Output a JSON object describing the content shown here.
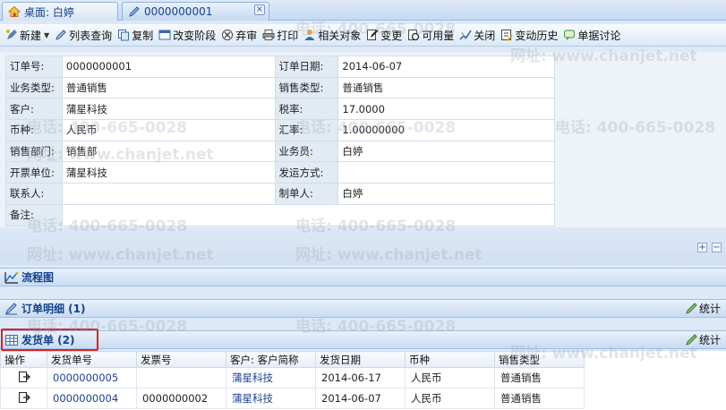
{
  "tabs": {
    "home_label": "桌面: 白婷",
    "doc_label": "0000000001",
    "close_glyph": "×"
  },
  "toolbar": {
    "new": "新建",
    "list_query": "列表查询",
    "copy": "复制",
    "change_stage": "改变阶段",
    "abandon": "弃审",
    "print": "打印",
    "related": "相关对象",
    "change": "变更",
    "available": "可用量",
    "close": "关闭",
    "history": "变动历史",
    "discuss": "单据讨论"
  },
  "form": {
    "order_no_label": "订单号:",
    "order_no": "0000000001",
    "order_date_label": "订单日期:",
    "order_date": "2014-06-07",
    "biz_type_label": "业务类型:",
    "biz_type": "普通销售",
    "sale_type_label": "销售类型:",
    "sale_type": "普通销售",
    "customer_label": "客户:",
    "customer": "蒲星科技",
    "tax_label": "税率:",
    "tax": "17.0000",
    "currency_label": "币种:",
    "currency": "人民币",
    "rate_label": "汇率:",
    "rate": "1.00000000",
    "dept_label": "销售部门:",
    "dept": "销售部",
    "salesman_label": "业务员:",
    "salesman": "白婷",
    "invoice_unit_label": "开票单位:",
    "invoice_unit": "蒲星科技",
    "ship_method_label": "发运方式:",
    "ship_method": "",
    "contact_label": "联系人:",
    "contact": "",
    "maker_label": "制单人:",
    "maker": "白婷",
    "remark_label": "备注:",
    "remark": ""
  },
  "panels": {
    "flow": "流程图",
    "order_detail": "订单明细 (1)",
    "delivery": "发货单 (2)",
    "stat": "统计",
    "expand_glyph": "+",
    "collapse_glyph": "−"
  },
  "grid": {
    "headers": [
      "操作",
      "发货单号",
      "发票号",
      "客户: 客户简称",
      "发货日期",
      "币种",
      "销售类型"
    ],
    "rows": [
      [
        "",
        "0000000005",
        "",
        "蒲星科技",
        "2014-06-17",
        "人民币",
        "普通销售"
      ],
      [
        "",
        "0000000004",
        "0000000002",
        "蒲星科技",
        "2014-06-07",
        "人民币",
        "普通销售"
      ]
    ]
  },
  "watermark": {
    "phone": "电话: 400-665-0028",
    "site": "网址: www.chanjet.net"
  },
  "colors": {
    "accent": "#15428b",
    "highlight": "#e02020"
  }
}
